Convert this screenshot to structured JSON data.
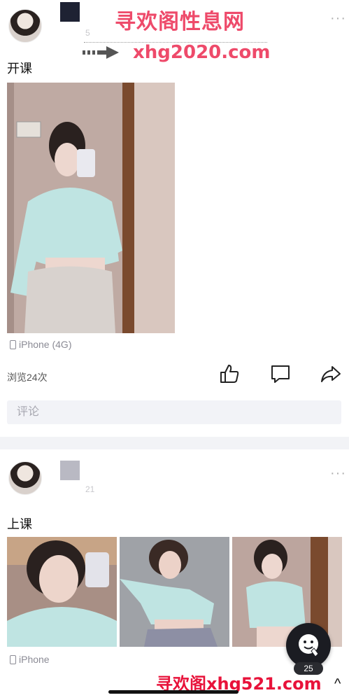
{
  "watermark": {
    "top_text": "寻欢阁性息网",
    "url_text": "xhg2020.com",
    "bottom_text": "寻欢阁xhg521.com"
  },
  "post1": {
    "meta_faint": "5",
    "text": "开课",
    "device": "iPhone (4G)",
    "views": "浏览24次",
    "comment_placeholder": "评论"
  },
  "post2": {
    "meta_faint": "21",
    "text": "上课",
    "device": "iPhone"
  },
  "fab": {
    "count": "25"
  },
  "icons": {
    "like": "thumbs-up-icon",
    "comment": "comment-bubble-icon",
    "share": "share-arrow-icon",
    "more": "more-dots-icon"
  },
  "colors": {
    "watermark": "#ee4a6a",
    "watermark_bottom": "#e8123a",
    "comment_bg": "#f2f3f7",
    "divider": "#f2f3f6"
  }
}
